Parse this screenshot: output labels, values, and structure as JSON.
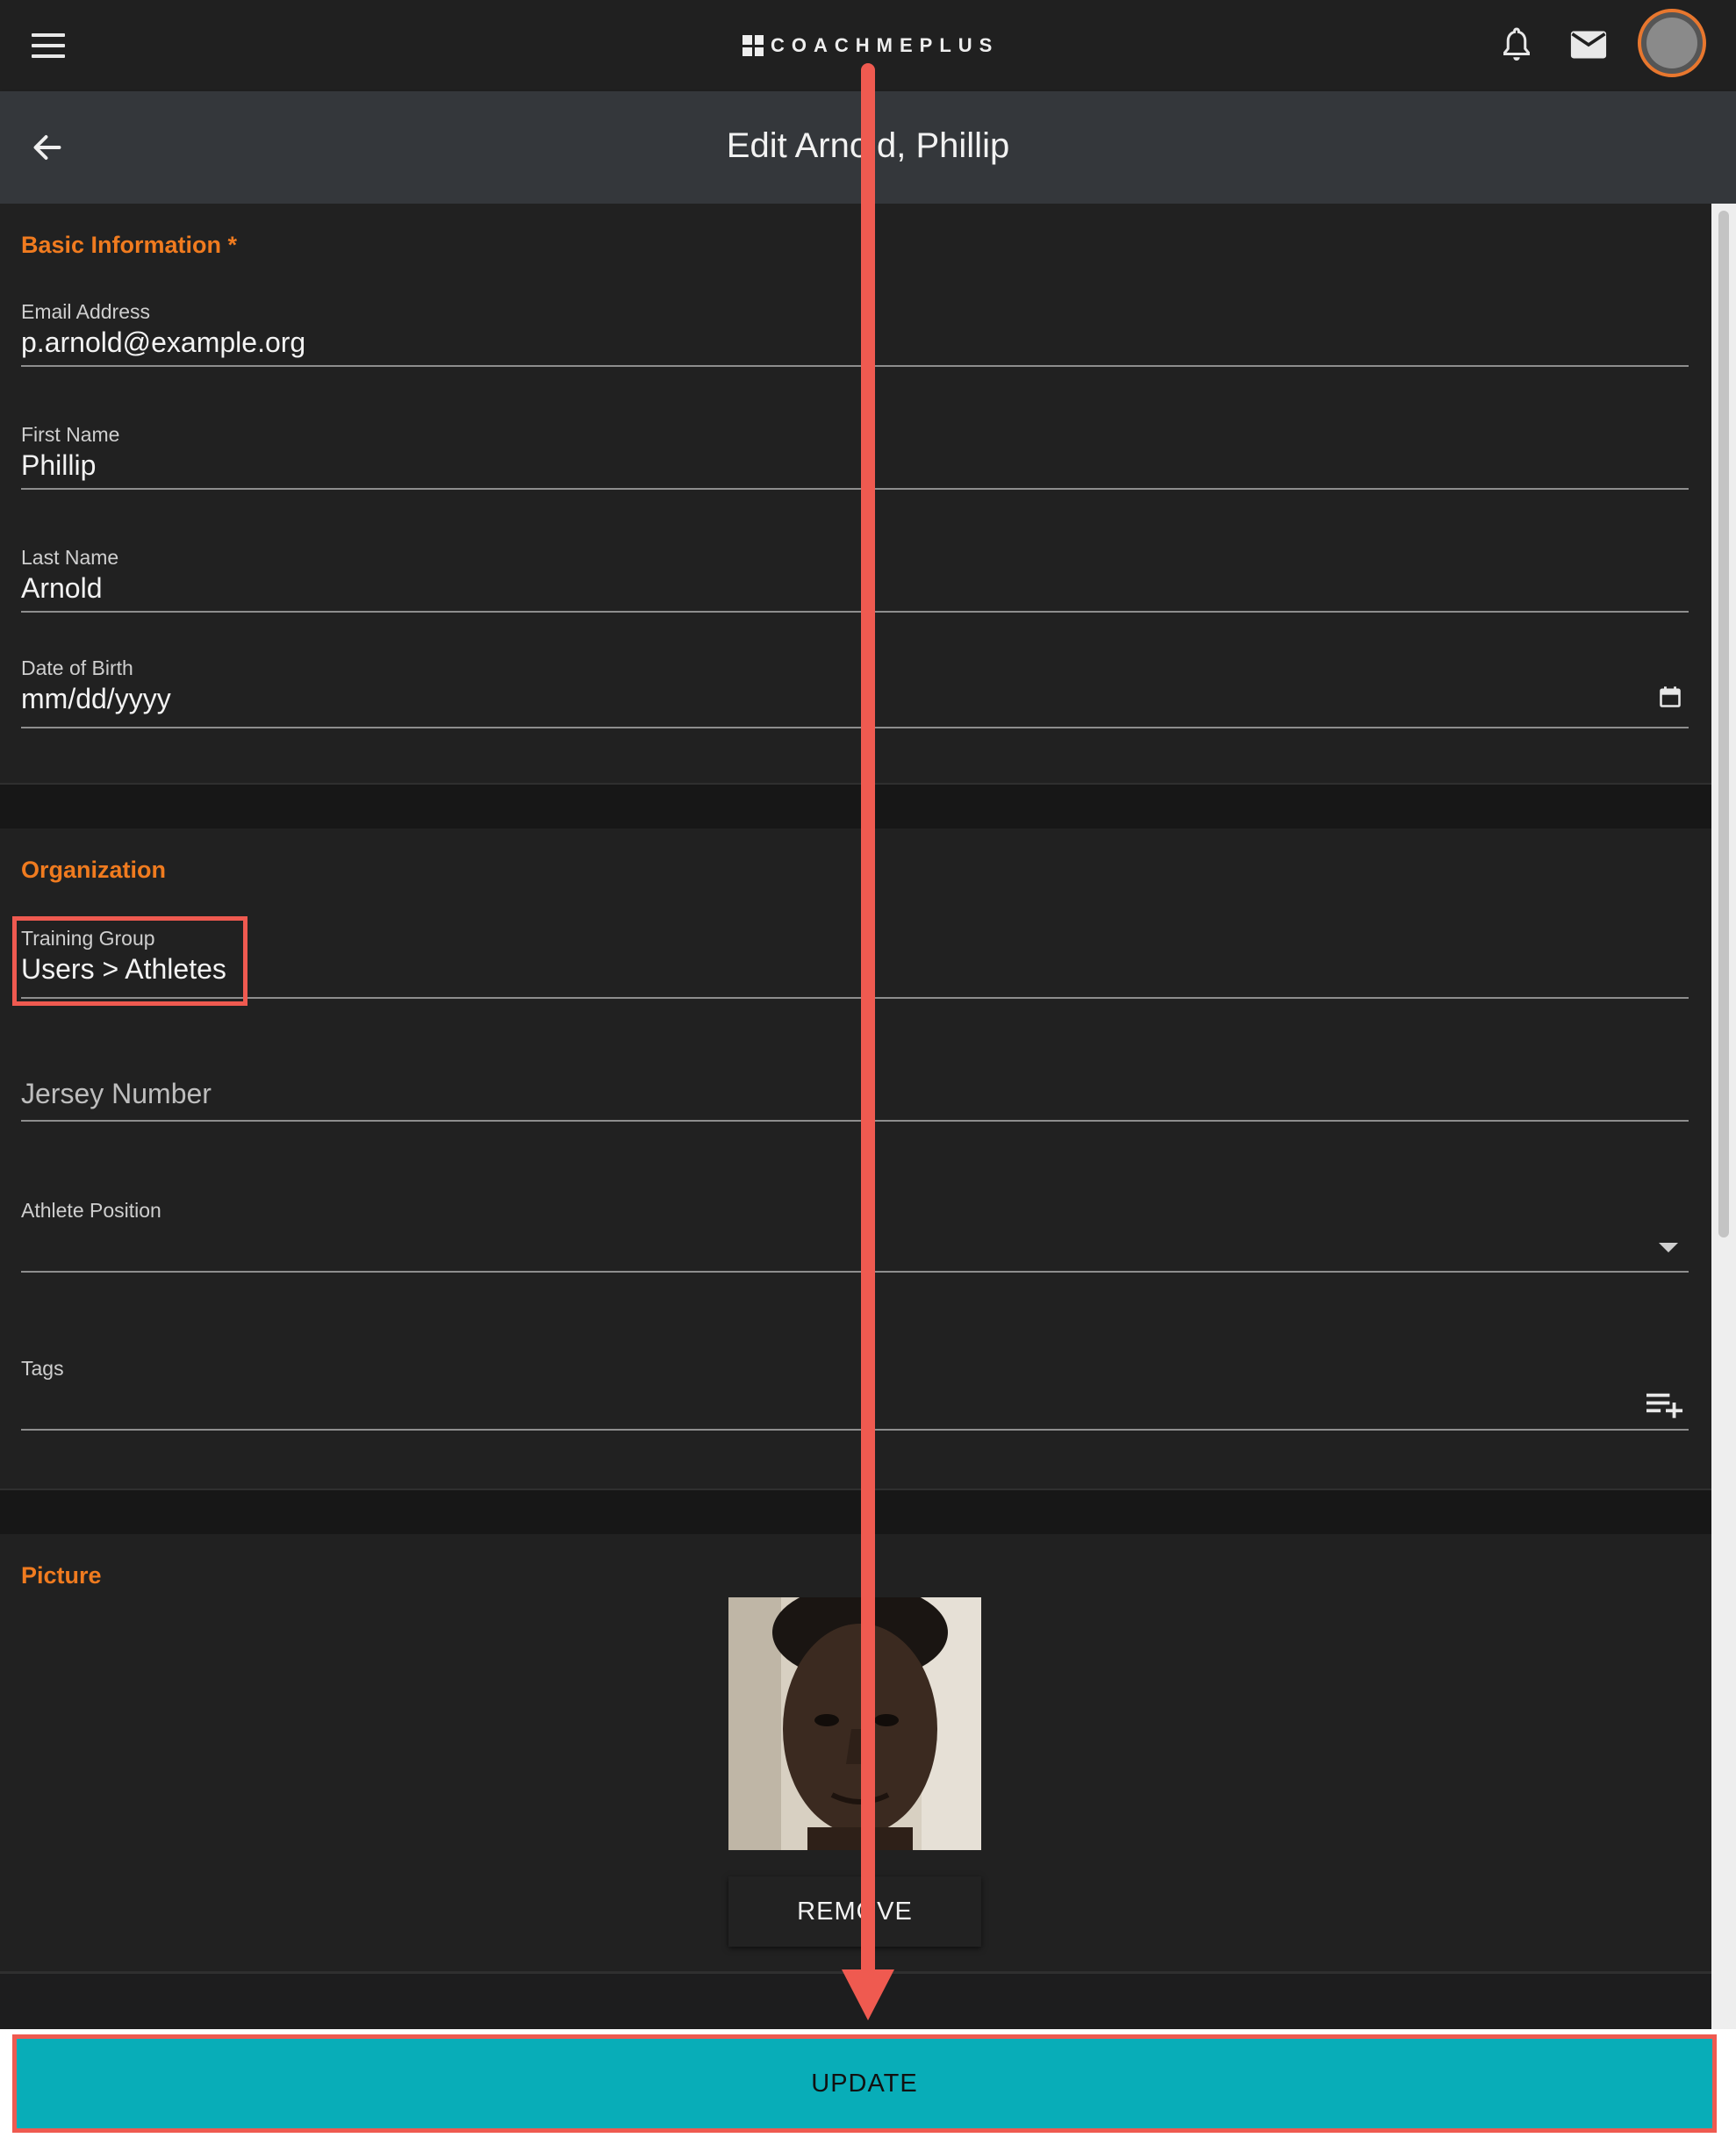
{
  "header": {
    "logo_text": "COACHMEPLUS",
    "icons": [
      "menu-icon",
      "bell-icon",
      "mail-icon",
      "avatar"
    ]
  },
  "subheader": {
    "title": "Edit Arnold, Phillip"
  },
  "basic_info": {
    "title": "Basic Information *",
    "email": {
      "label": "Email Address",
      "value": "p.arnold@example.org"
    },
    "first_name": {
      "label": "First Name",
      "value": "Phillip"
    },
    "last_name": {
      "label": "Last Name",
      "value": "Arnold"
    },
    "dob": {
      "label": "Date of Birth",
      "value": "mm/dd/yyyy"
    }
  },
  "organization": {
    "title": "Organization",
    "training_group": {
      "label": "Training Group",
      "value": "Users > Athletes"
    },
    "jersey": {
      "placeholder": "Jersey Number"
    },
    "position": {
      "label": "Athlete Position",
      "value": ""
    },
    "tags": {
      "label": "Tags",
      "value": ""
    }
  },
  "picture": {
    "title": "Picture",
    "remove_label": "REMOVE"
  },
  "footer": {
    "update_label": "UPDATE"
  },
  "colors": {
    "accent": "#f07b1f",
    "update": "#08adb8",
    "annotation": "#ef5a50"
  }
}
